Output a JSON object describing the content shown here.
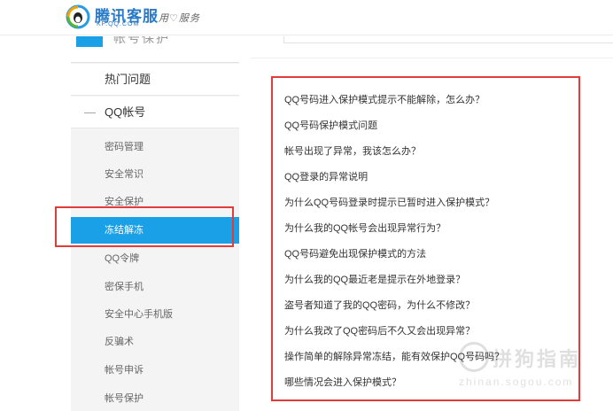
{
  "header": {
    "logo_title": "腾讯客服",
    "logo_sub": "KF.QQ.COM",
    "slogan": "用♡服务"
  },
  "sidebar": {
    "head_title": "帐号保护",
    "hot_label": "热门问题",
    "collapse_mark": "—",
    "qq_label": "QQ帐号",
    "sub_items": [
      {
        "label": "密码管理"
      },
      {
        "label": "安全常识"
      },
      {
        "label": "安全保护"
      },
      {
        "label": "冻结解冻"
      },
      {
        "label": "QQ令牌"
      },
      {
        "label": "密保手机"
      },
      {
        "label": "安全中心手机版"
      },
      {
        "label": "反骗术"
      },
      {
        "label": "帐号申诉"
      },
      {
        "label": "帐号保护"
      }
    ],
    "active_item": "冻结解冻"
  },
  "faq": {
    "items": [
      {
        "label": "QQ号码进入保护模式提示不能解除，怎么办？"
      },
      {
        "label": "QQ号码保护模式问题"
      },
      {
        "label": "帐号出现了异常，我该怎么办？"
      },
      {
        "label": "QQ登录的异常说明"
      },
      {
        "label": "为什么QQ号码登录时提示已暂时进入保护模式？"
      },
      {
        "label": "为什么我的QQ帐号会出现异常行为？"
      },
      {
        "label": "QQ号码避免出现保护模式的方法"
      },
      {
        "label": "为什么我的QQ最近老是提示在外地登录？"
      },
      {
        "label": "盗号者知道了我的QQ密码，为什么不修改？"
      },
      {
        "label": "为什么我改了QQ密码后不久又会出现异常？"
      },
      {
        "label": "操作简单的解除异常冻结，能有效保护QQ号码吗？"
      },
      {
        "label": "哪些情况会进入保护模式？"
      }
    ]
  },
  "watermark": {
    "title": "拼狗指南",
    "url": "zhinan.sogou.com"
  },
  "colors": {
    "accent_blue": "#1aa0e6",
    "highlight_red": "#e03c3c"
  }
}
